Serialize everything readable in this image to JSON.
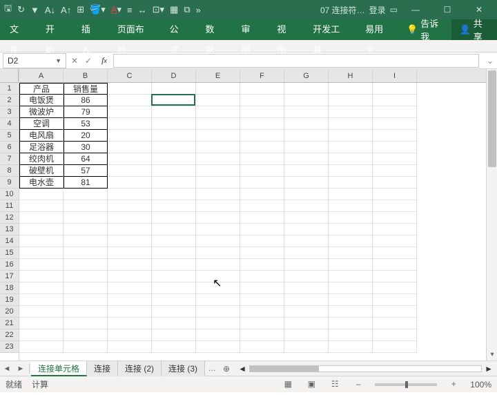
{
  "titlebar": {
    "doc": "07 连接符…",
    "login": "登录",
    "qat_icons": [
      "save",
      "redo",
      "filter",
      "sort-asc",
      "sort-desc",
      "table",
      "fill-color",
      "font-color",
      "align",
      "column-width",
      "border",
      "freeze",
      "grid",
      "window",
      "more"
    ]
  },
  "ribbon": {
    "tabs": [
      "文件",
      "开始",
      "插入",
      "页面布局",
      "公式",
      "数据",
      "审阅",
      "视图",
      "开发工具",
      "易用宝"
    ],
    "tellme": "告诉我",
    "share": "共享"
  },
  "namebox": "D2",
  "formula": "",
  "columns": [
    "A",
    "B",
    "C",
    "D",
    "E",
    "F",
    "G",
    "H",
    "I"
  ],
  "rowcount": 23,
  "table": {
    "headers": [
      "产品",
      "销售量"
    ],
    "rows": [
      [
        "电饭煲",
        "86"
      ],
      [
        "微波炉",
        "79"
      ],
      [
        "空调",
        "53"
      ],
      [
        "电风扇",
        "20"
      ],
      [
        "足浴器",
        "30"
      ],
      [
        "绞肉机",
        "64"
      ],
      [
        "破壁机",
        "57"
      ],
      [
        "电水壶",
        "81"
      ]
    ]
  },
  "worksheets": {
    "nav": [
      "◄",
      "►"
    ],
    "tabs": [
      "连接单元格",
      "连接",
      "连接 (2)",
      "连接 (3)"
    ],
    "new": "…",
    "add": "⊕"
  },
  "status": {
    "mode": "就绪",
    "calc": "计算",
    "zoom": "100%"
  },
  "activecell": {
    "col": 3,
    "row": 1
  }
}
